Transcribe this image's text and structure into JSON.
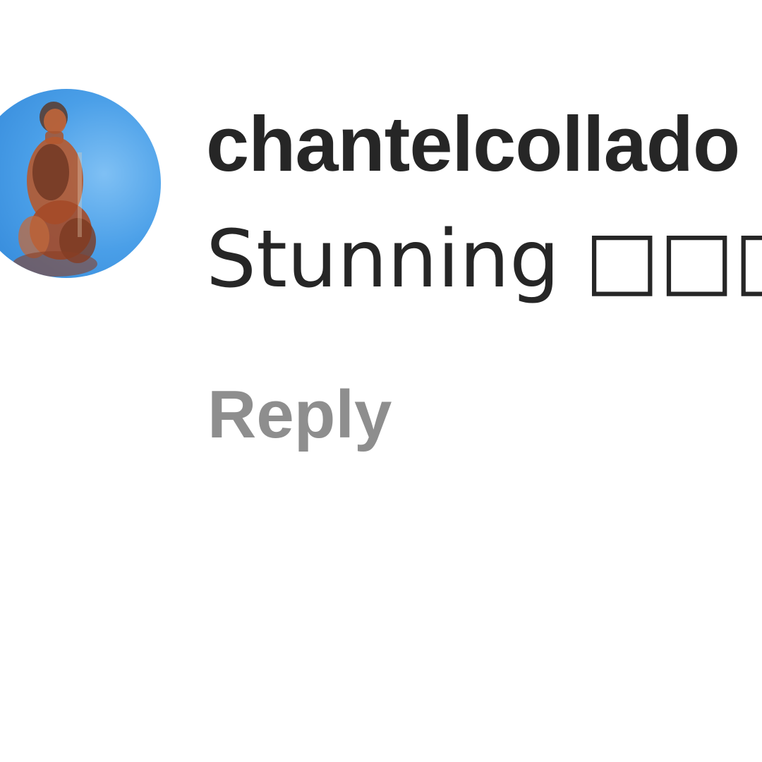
{
  "comment": {
    "username": "chantelcollado",
    "text": "Stunning □□□",
    "reply_label": "Reply",
    "avatar_icon": "profile-photo"
  },
  "colors": {
    "text_primary": "#262626",
    "text_secondary": "#8e8e8e",
    "avatar_background": "#4a9fe8"
  }
}
